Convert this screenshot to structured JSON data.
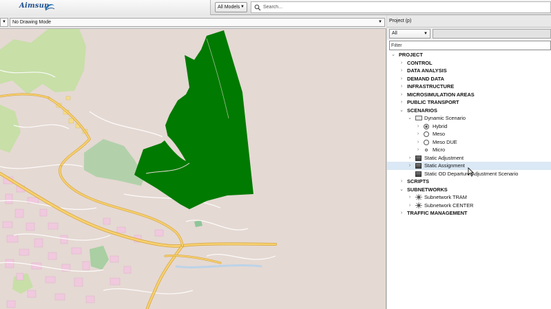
{
  "app": {
    "logo_text": "Aimsun"
  },
  "topbar": {
    "models_select": "All Models",
    "search_placeholder": "Search...",
    "search_icon": "search-icon"
  },
  "map_toolbar": {
    "drawing_mode": "No Drawing Mode"
  },
  "project_panel": {
    "title": "Project (p)",
    "type_select": "All",
    "filter_placeholder": "Filter",
    "tree": [
      {
        "label": "PROJECT",
        "arrow": "expanded",
        "bold": true,
        "icon": ""
      },
      {
        "label": "CONTROL",
        "arrow": "collapsed",
        "bold": true,
        "icon": ""
      },
      {
        "label": "DATA ANALYSIS",
        "arrow": "collapsed",
        "bold": true,
        "icon": ""
      },
      {
        "label": "DEMAND DATA",
        "arrow": "collapsed",
        "bold": true,
        "icon": ""
      },
      {
        "label": "INFRASTRUCTURE",
        "arrow": "collapsed",
        "bold": true,
        "icon": ""
      },
      {
        "label": "MICROSIMULATION AREAS",
        "arrow": "collapsed",
        "bold": true,
        "icon": ""
      },
      {
        "label": "PUBLIC TRANSPORT",
        "arrow": "collapsed",
        "bold": true,
        "icon": ""
      },
      {
        "label": "SCENARIOS",
        "arrow": "expanded",
        "bold": true,
        "icon": ""
      },
      {
        "label": "Dynamic Scenario",
        "arrow": "expanded",
        "bold": false,
        "icon": "scenario-icon"
      },
      {
        "label": "Hybrid",
        "arrow": "collapsed",
        "bold": false,
        "icon": "radio-selected-icon"
      },
      {
        "label": "Meso",
        "arrow": "collapsed",
        "bold": false,
        "icon": "radio-icon"
      },
      {
        "label": "Meso DUE",
        "arrow": "collapsed",
        "bold": false,
        "icon": "radio-icon"
      },
      {
        "label": "Micro",
        "arrow": "collapsed",
        "bold": false,
        "icon": "dot-icon"
      },
      {
        "label": "Static Adjustment",
        "arrow": "collapsed",
        "bold": false,
        "icon": "static-scenario-icon"
      },
      {
        "label": "Static Assignment",
        "arrow": "collapsed",
        "bold": false,
        "icon": "static-scenario-icon"
      },
      {
        "label": "Static OD Departure Adjustment Scenario",
        "arrow": "",
        "bold": false,
        "icon": "static-scenario-icon"
      },
      {
        "label": "SCRIPTS",
        "arrow": "collapsed",
        "bold": true,
        "icon": ""
      },
      {
        "label": "SUBNETWORKS",
        "arrow": "expanded",
        "bold": true,
        "icon": ""
      },
      {
        "label": "Subnetwork TRAM",
        "arrow": "collapsed",
        "bold": false,
        "icon": "subnetwork-icon"
      },
      {
        "label": "Subnetwork CENTER",
        "arrow": "collapsed",
        "bold": false,
        "icon": "subnetwork-icon"
      },
      {
        "label": "TRAFFIC MANAGEMENT",
        "arrow": "collapsed",
        "bold": true,
        "icon": ""
      }
    ]
  }
}
